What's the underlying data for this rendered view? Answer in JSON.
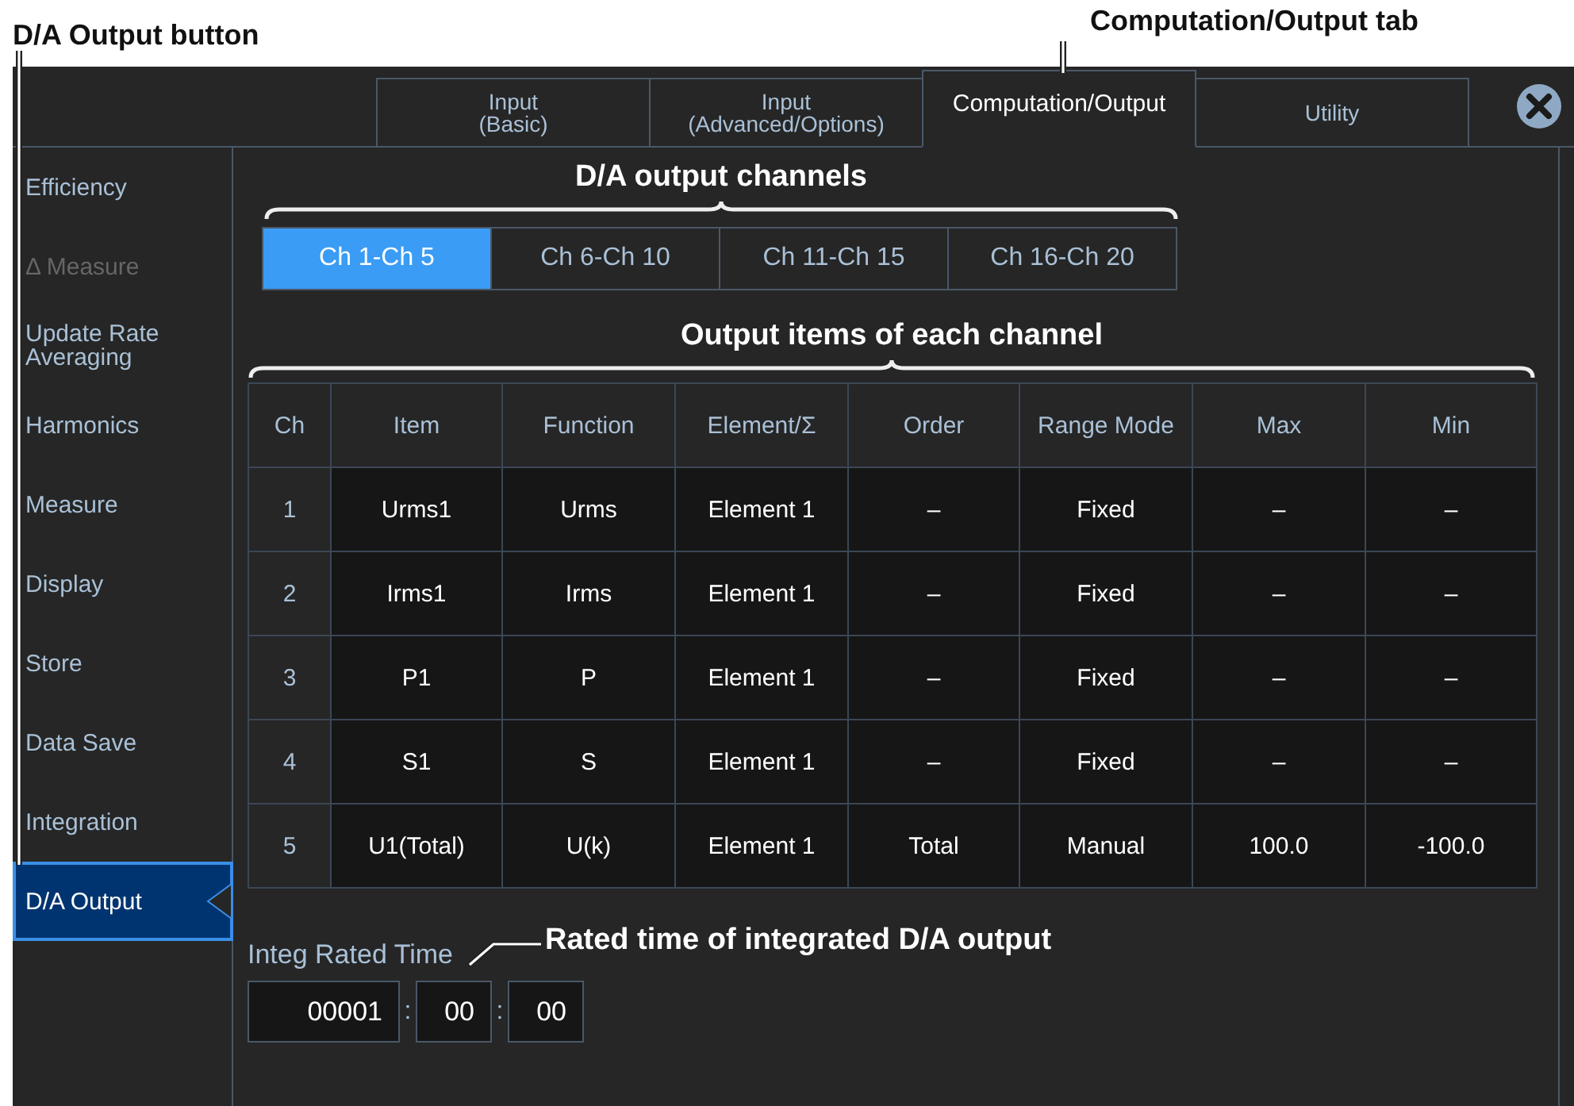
{
  "callouts": {
    "da_output_button": "D/A Output button",
    "computation_output_tab": "Computation/Output tab",
    "output_channels": "D/A output channels",
    "output_items": "Output items of each channel",
    "rated_time": "Rated time of integrated D/A output"
  },
  "tabs": [
    {
      "label": "Input\n(Basic)",
      "selected": false
    },
    {
      "label": "Input\n(Advanced/Options)",
      "selected": false
    },
    {
      "label": "Computation/Output",
      "selected": true
    },
    {
      "label": "Utility",
      "selected": false
    }
  ],
  "sidebar": {
    "items": [
      {
        "label": "Efficiency",
        "selected": false,
        "disabled": false
      },
      {
        "label": "Δ Measure",
        "selected": false,
        "disabled": true
      },
      {
        "label": "Update Rate\nAveraging",
        "selected": false,
        "disabled": false
      },
      {
        "label": "Harmonics",
        "selected": false,
        "disabled": false
      },
      {
        "label": "Measure",
        "selected": false,
        "disabled": false
      },
      {
        "label": "Display",
        "selected": false,
        "disabled": false
      },
      {
        "label": "Store",
        "selected": false,
        "disabled": false
      },
      {
        "label": "Data Save",
        "selected": false,
        "disabled": false
      },
      {
        "label": "Integration",
        "selected": false,
        "disabled": false
      },
      {
        "label": "D/A Output",
        "selected": true,
        "disabled": false
      }
    ]
  },
  "channel_groups": [
    {
      "label": "Ch 1-Ch 5",
      "selected": true
    },
    {
      "label": "Ch 6-Ch 10",
      "selected": false
    },
    {
      "label": "Ch 11-Ch 15",
      "selected": false
    },
    {
      "label": "Ch 16-Ch 20",
      "selected": false
    }
  ],
  "table": {
    "columns": [
      "Ch",
      "Item",
      "Function",
      "Element/Σ",
      "Order",
      "Range Mode",
      "Max",
      "Min"
    ],
    "rows": [
      [
        "1",
        "Urms1",
        "Urms",
        "Element 1",
        "–",
        "Fixed",
        "–",
        "–"
      ],
      [
        "2",
        "Irms1",
        "Irms",
        "Element 1",
        "–",
        "Fixed",
        "–",
        "–"
      ],
      [
        "3",
        "P1",
        "P",
        "Element 1",
        "–",
        "Fixed",
        "–",
        "–"
      ],
      [
        "4",
        "S1",
        "S",
        "Element 1",
        "–",
        "Fixed",
        "–",
        "–"
      ],
      [
        "5",
        "U1(Total)",
        "U(k)",
        "Element 1",
        "Total",
        "Manual",
        "100.0",
        "-100.0"
      ]
    ]
  },
  "integ_rated_time": {
    "label": "Integ Rated Time",
    "fields": [
      "00001",
      "00",
      "00"
    ],
    "separators": [
      ":",
      ":"
    ]
  }
}
